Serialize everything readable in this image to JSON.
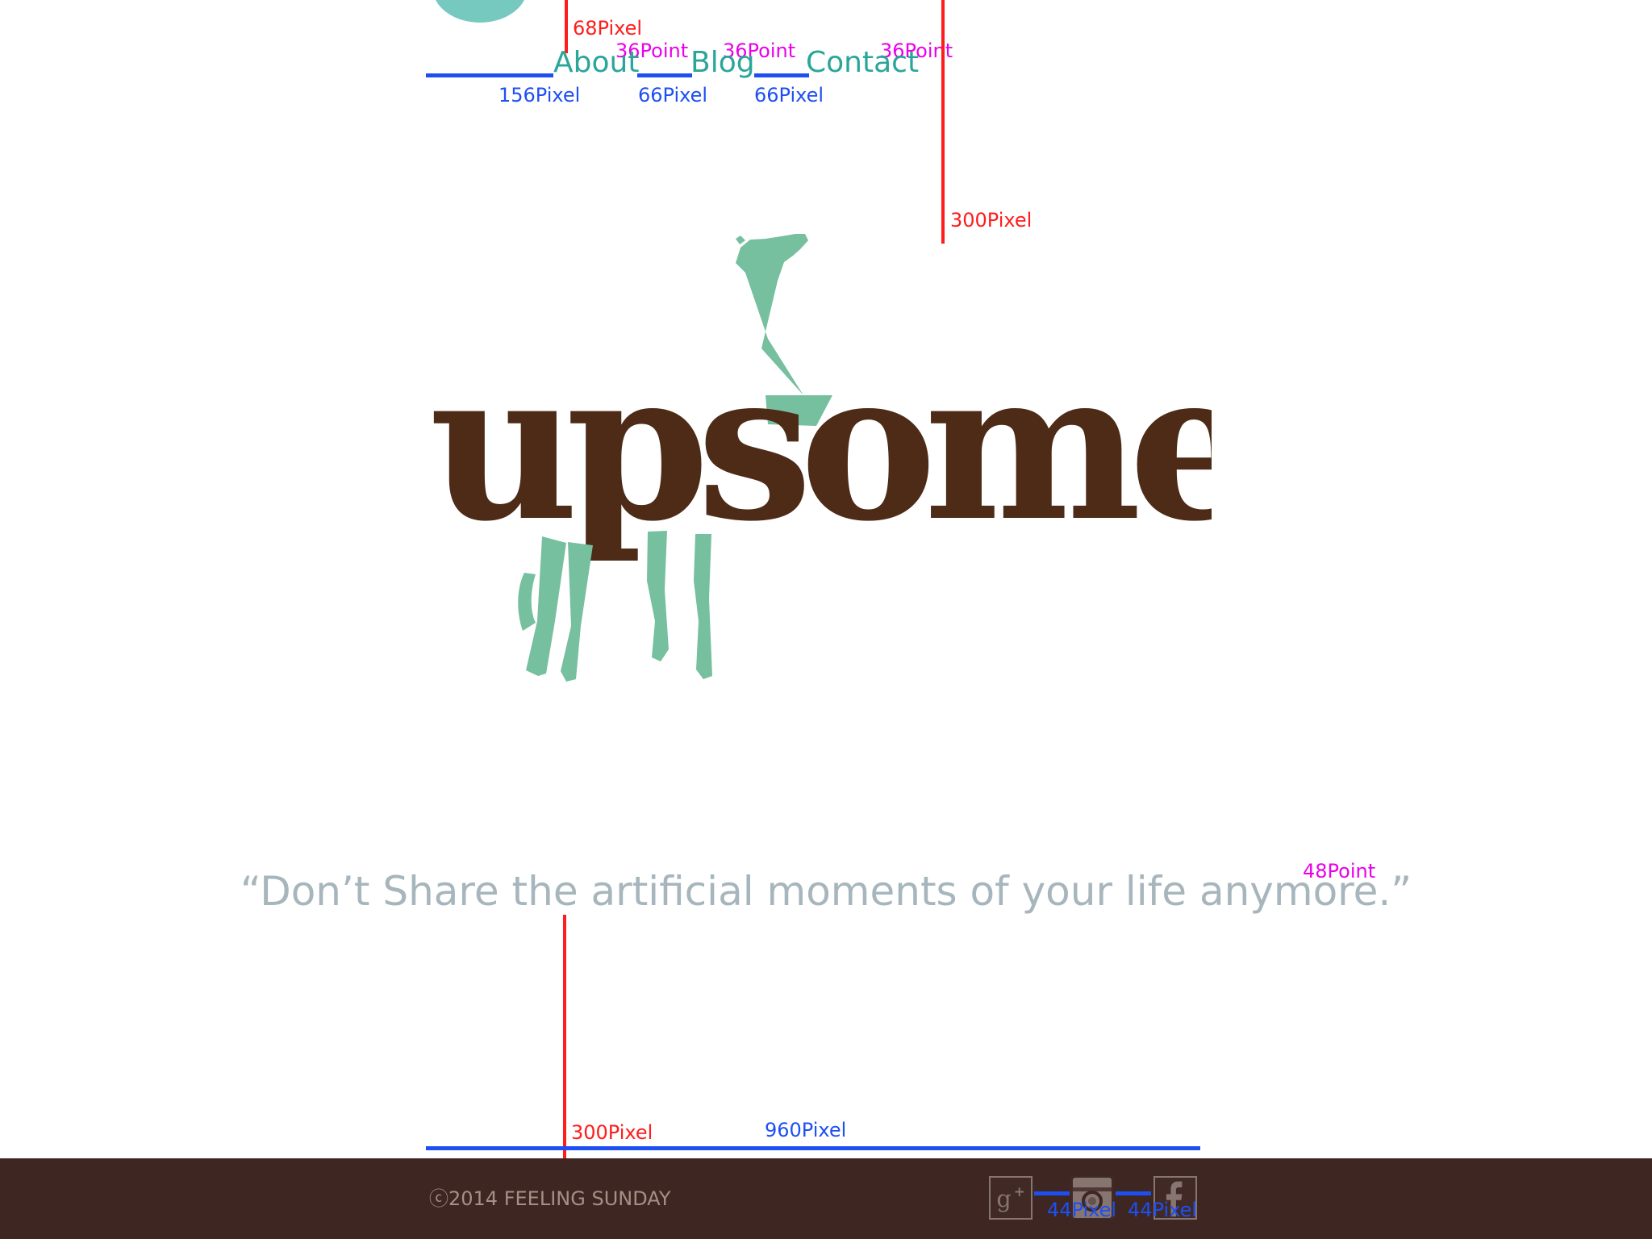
{
  "header": {
    "nav_items": [
      {
        "label": "About"
      },
      {
        "label": "Blog"
      },
      {
        "label": "Contact"
      }
    ]
  },
  "hero": {
    "brand_name": "upsome",
    "tagline": "“Don’t Share the artificial moments of your life anymore.”"
  },
  "footer": {
    "copyright": "ⓒ2014 FEELING SUNDAY",
    "social": [
      {
        "icon": "google-plus-icon"
      },
      {
        "icon": "instagram-icon"
      },
      {
        "icon": "facebook-icon"
      }
    ]
  },
  "specs": {
    "top_margin": "68Pixel",
    "nav_gap_1": "156Pixel",
    "nav_gap_2": "66Pixel",
    "nav_gap_3": "66Pixel",
    "nav_font_1": "36Point",
    "nav_font_2": "36Point",
    "nav_font_3": "36Point",
    "logo_spacing": "300Pixel",
    "tagline_font": "48Point",
    "bottom_spacing": "300Pixel",
    "content_width": "960Pixel",
    "social_gap_1": "44Pixel",
    "social_gap_2": "44Pixel"
  },
  "colors": {
    "accent": "#2aa699",
    "brand_brown": "#4d2b17",
    "brand_green": "#76bf9f",
    "tagline": "#a7b6bc",
    "footer_bg": "#3e2622",
    "spec_red": "#ff1c1c",
    "spec_blue": "#1d4ff3",
    "spec_magenta": "#ea00ea"
  }
}
